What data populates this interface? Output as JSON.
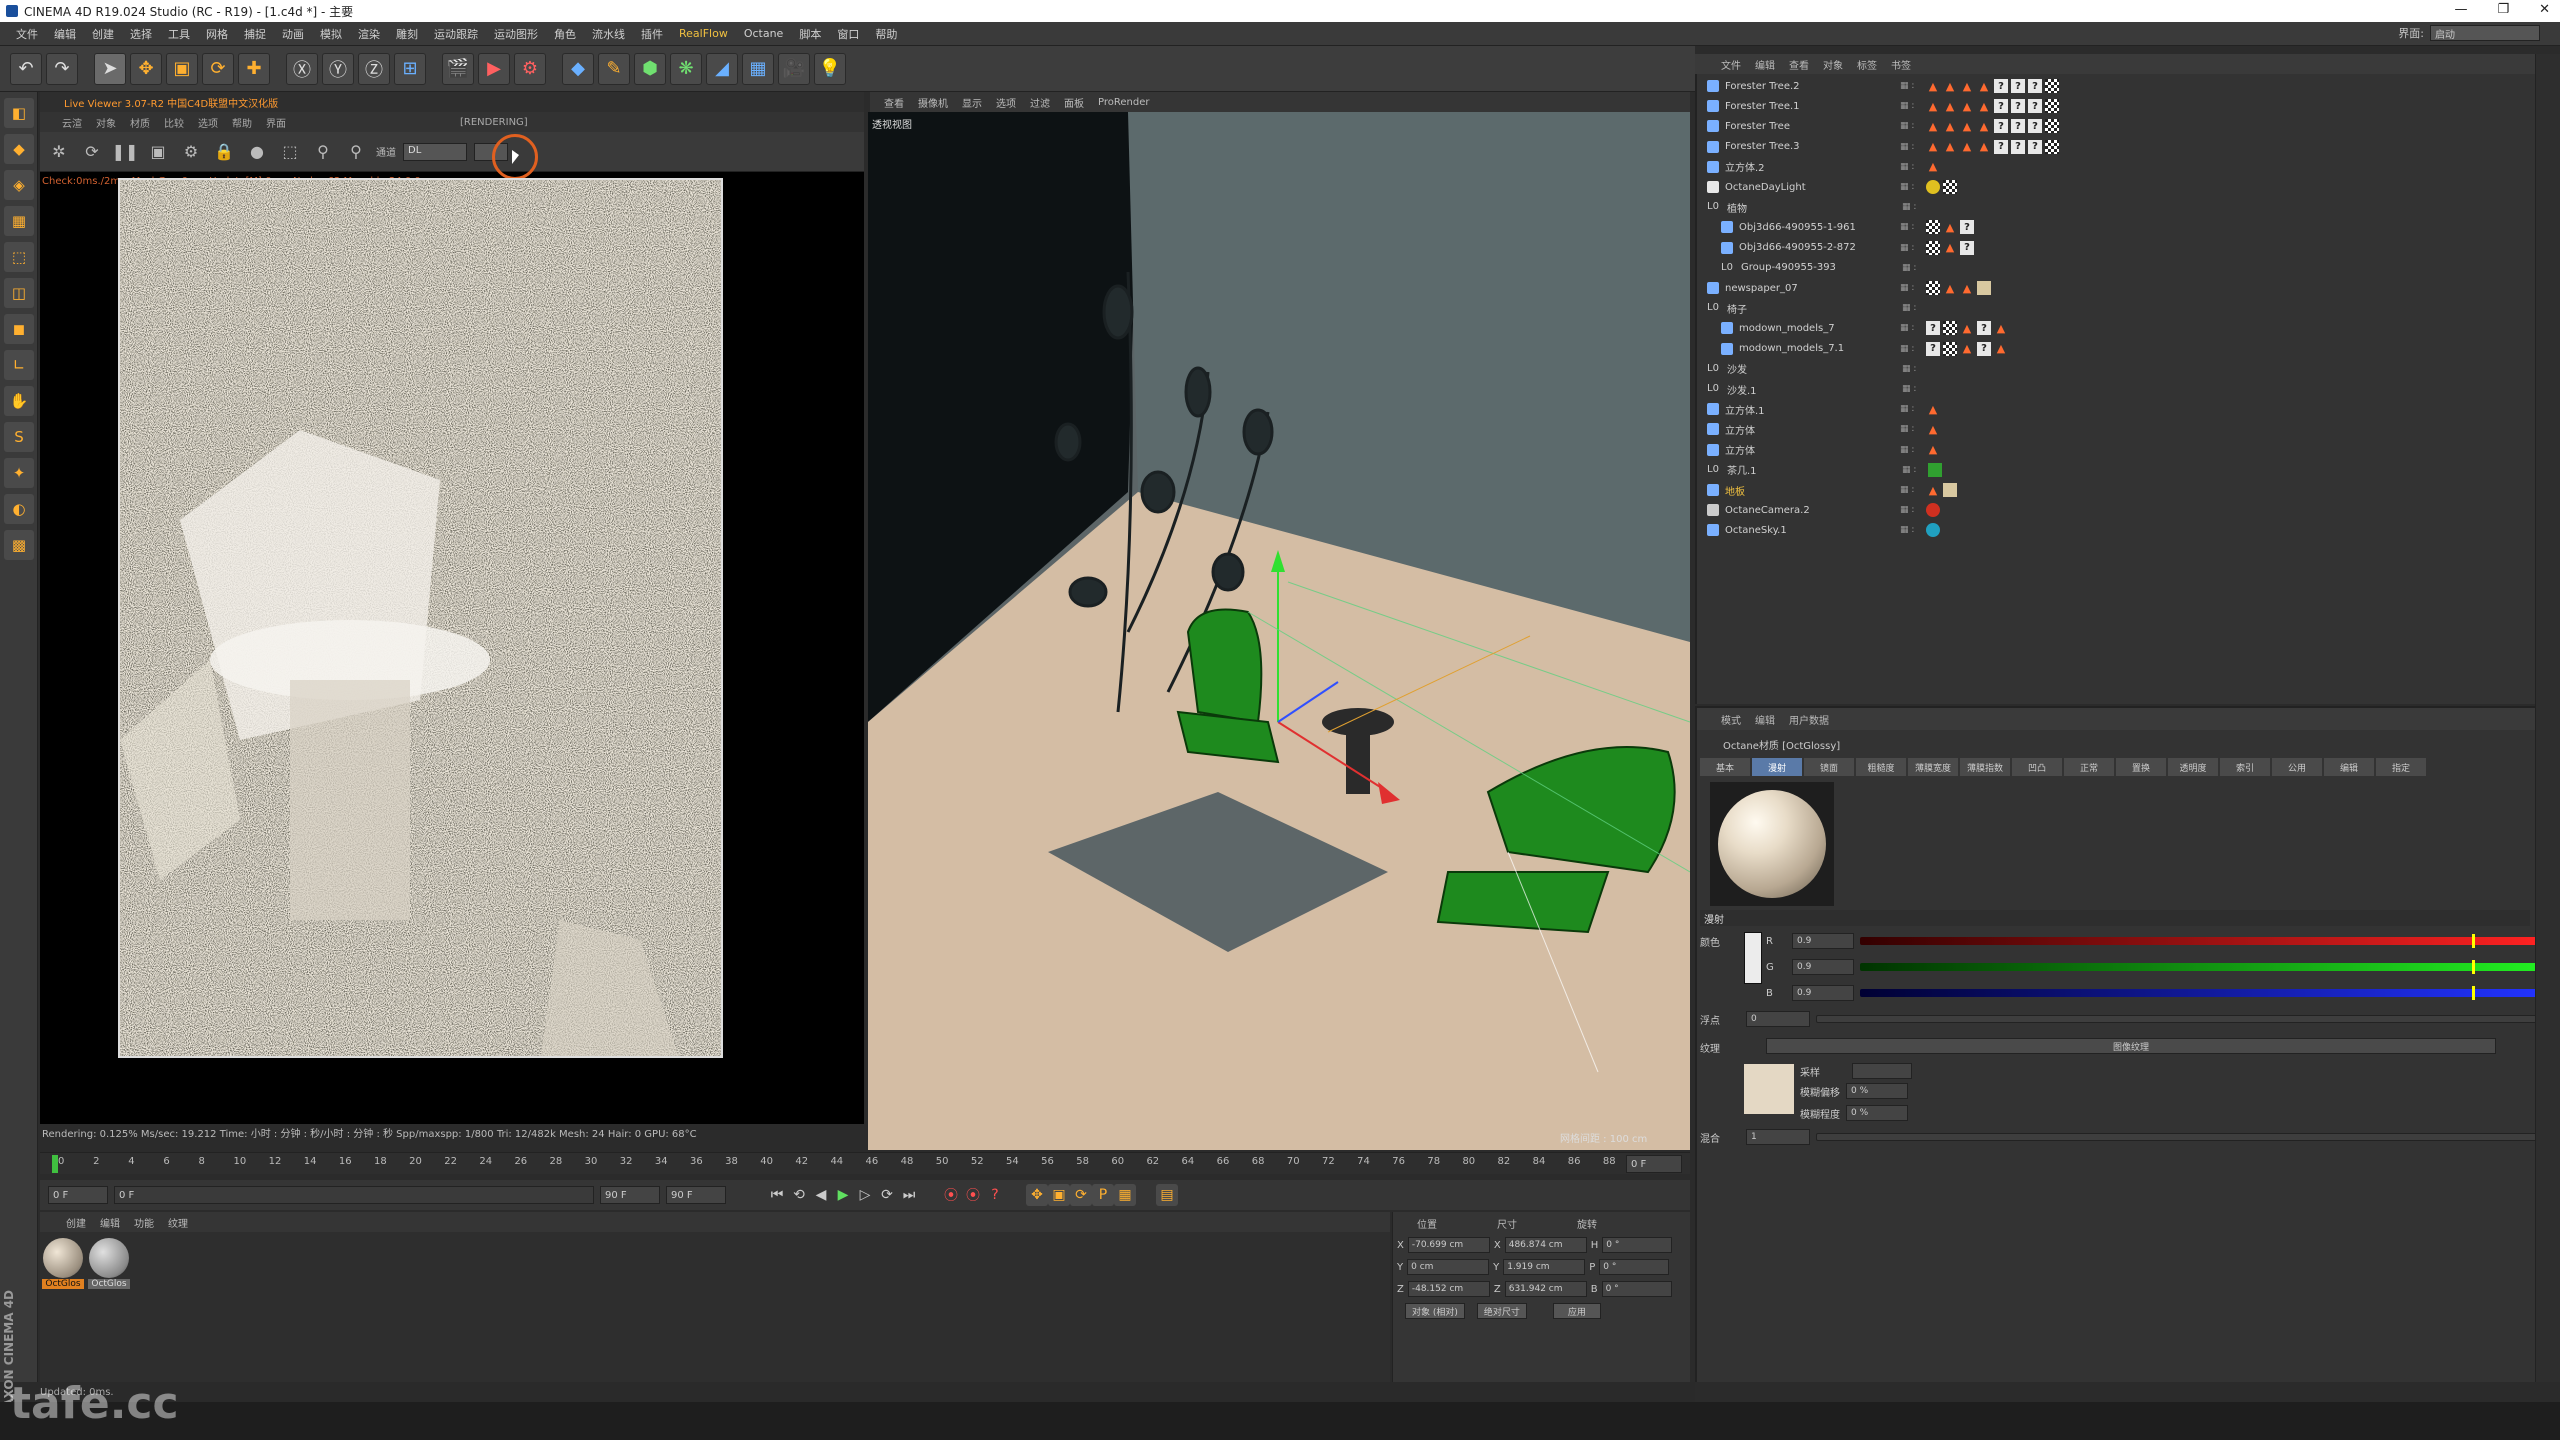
{
  "window": {
    "title": "CINEMA 4D R19.024 Studio (RC - R19) - [1.c4d *] - 主要"
  },
  "menubar": {
    "items": [
      "文件",
      "编辑",
      "创建",
      "选择",
      "工具",
      "网格",
      "捕捉",
      "动画",
      "模拟",
      "渲染",
      "雕刻",
      "运动跟踪",
      "运动图形",
      "角色",
      "流水线",
      "插件",
      "RealFlow",
      "Octane",
      "脚本",
      "窗口",
      "帮助"
    ],
    "layout_label": "界面:",
    "layout_value": "启动"
  },
  "colors": {
    "accent_orange": "#e06020",
    "green_object": "#1e8a1e",
    "floor": "#d9bfa4"
  },
  "live_viewer": {
    "title": "Live Viewer 3.07-R2 中国C4D联盟中文汉化版",
    "menu": [
      "云渲",
      "对象",
      "材质",
      "比较",
      "选项",
      "帮助",
      "界面"
    ],
    "rendering_tag": "[RENDERING]",
    "channel_label": "通道",
    "channel_value": "DL",
    "status_line": "Check:0ms./2ms. MeshGen:0ms. Update[M]:0ms. Nodes:62 Movable:24 0 0",
    "render_status": "Rendering: 0.125%  Ms/sec: 19.212   Time: 小时 : 分钟 : 秒/小时 : 分钟 : 秒   Spp/maxspp: 1/800    Tri: 12/482k   Mesh: 24   Hair: 0    GPU: 68°C"
  },
  "viewport": {
    "menu": [
      "查看",
      "摄像机",
      "显示",
      "选项",
      "过滤",
      "面板",
      "ProRender"
    ],
    "label": "透视视图",
    "grid_text": "网格间距 : 100 cm"
  },
  "timeline": {
    "ticks": [
      "0",
      "2",
      "4",
      "6",
      "8",
      "10",
      "12",
      "14",
      "16",
      "18",
      "20",
      "22",
      "24",
      "26",
      "28",
      "30",
      "32",
      "34",
      "36",
      "38",
      "40",
      "42",
      "44",
      "46",
      "48",
      "50",
      "52",
      "54",
      "56",
      "58",
      "60",
      "62",
      "64",
      "66",
      "68",
      "70",
      "72",
      "74",
      "76",
      "78",
      "80",
      "82",
      "84",
      "86",
      "88",
      "90"
    ],
    "current_frame": "0 F",
    "start": "0 F",
    "range_start": "0 F",
    "range_end": "90 F",
    "end": "90 F"
  },
  "material_manager": {
    "menu": [
      "创建",
      "编辑",
      "功能",
      "纹理"
    ],
    "materials": [
      "OctGlos",
      "OctGlos"
    ]
  },
  "coordinates": {
    "headers": [
      "位置",
      "尺寸",
      "旋转"
    ],
    "rows": [
      {
        "axis": "X",
        "pos": "-70.699 cm",
        "size_axis": "X",
        "size": "486.874 cm",
        "rot_axis": "H",
        "rot": "0 °"
      },
      {
        "axis": "Y",
        "pos": "0 cm",
        "size_axis": "Y",
        "size": "1.919 cm",
        "rot_axis": "P",
        "rot": "0 °"
      },
      {
        "axis": "Z",
        "pos": "-48.152 cm",
        "size_axis": "Z",
        "size": "631.942 cm",
        "rot_axis": "B",
        "rot": "0 °"
      }
    ],
    "mode": "对象 (相对)",
    "size_mode": "绝对尺寸",
    "apply": "应用"
  },
  "object_manager": {
    "menu": [
      "文件",
      "编辑",
      "查看",
      "对象",
      "标签",
      "书签"
    ],
    "objects": [
      {
        "name": "Forester Tree.2",
        "indent": 0,
        "icon": "tree",
        "tags": "trees"
      },
      {
        "name": "Forester Tree.1",
        "indent": 0,
        "icon": "tree",
        "tags": "trees"
      },
      {
        "name": "Forester Tree",
        "indent": 0,
        "icon": "tree",
        "tags": "trees"
      },
      {
        "name": "Forester Tree.3",
        "indent": 0,
        "icon": "tree",
        "tags": "trees"
      },
      {
        "name": "立方体.2",
        "indent": 0,
        "icon": "cube",
        "tags": "one"
      },
      {
        "name": "OctaneDayLight",
        "indent": 0,
        "icon": "light",
        "tags": "light"
      },
      {
        "name": "植物",
        "indent": 0,
        "icon": "null",
        "tags": ""
      },
      {
        "name": "Obj3d66-490955-1-961",
        "indent": 1,
        "icon": "poly",
        "tags": "mix"
      },
      {
        "name": "Obj3d66-490955-2-872",
        "indent": 1,
        "icon": "poly",
        "tags": "mix"
      },
      {
        "name": "Group-490955-393",
        "indent": 1,
        "icon": "null",
        "tags": ""
      },
      {
        "name": "newspaper_07",
        "indent": 0,
        "icon": "poly",
        "tags": "paper"
      },
      {
        "name": "椅子",
        "indent": 0,
        "icon": "null",
        "tags": ""
      },
      {
        "name": "modown_models_7",
        "indent": 1,
        "icon": "poly",
        "tags": "mix2"
      },
      {
        "name": "modown_models_7.1",
        "indent": 1,
        "icon": "poly",
        "tags": "mix2"
      },
      {
        "name": "沙发",
        "indent": 0,
        "icon": "null",
        "tags": ""
      },
      {
        "name": "沙发.1",
        "indent": 0,
        "icon": "null",
        "tags": ""
      },
      {
        "name": "立方体.1",
        "indent": 0,
        "icon": "cube",
        "tags": "one"
      },
      {
        "name": "立方体",
        "indent": 0,
        "icon": "cube",
        "tags": "one"
      },
      {
        "name": "立方体",
        "indent": 0,
        "icon": "cube",
        "tags": "one"
      },
      {
        "name": "茶几.1",
        "indent": 0,
        "icon": "null",
        "tags": "green"
      },
      {
        "name": "地板",
        "indent": 0,
        "icon": "cube",
        "tags": "floor"
      },
      {
        "name": "OctaneCamera.2",
        "indent": 0,
        "icon": "camera",
        "tags": "cam"
      },
      {
        "name": "OctaneSky.1",
        "indent": 0,
        "icon": "sky",
        "tags": "sky"
      }
    ]
  },
  "attributes": {
    "menu": [
      "模式",
      "编辑",
      "用户数据"
    ],
    "title": "Octane材质 [OctGlossy]",
    "tabs": [
      "基本",
      "漫射",
      "镜面",
      "粗糙度",
      "薄膜宽度",
      "薄膜指数",
      "凹凸",
      "正常",
      "置换",
      "透明度",
      "索引",
      "公用",
      "编辑",
      "指定"
    ],
    "active_tab": 1,
    "section": "漫射",
    "color_label": "颜色",
    "r_label": "R",
    "r_value": "0.9",
    "r_level": 0.9,
    "g_label": "G",
    "g_value": "0.9",
    "g_level": 0.9,
    "b_label": "B",
    "b_value": "0.9",
    "b_level": 0.9,
    "float_label": "浮点",
    "float_value": "0",
    "texture_label": "纹理",
    "texture_name": "图像纹理",
    "sampling_label": "采样",
    "blur_offset_label": "模糊偏移",
    "blur_offset_value": "0 %",
    "blur_scale_label": "模糊程度",
    "blur_scale_value": "0 %",
    "mix_label": "混合",
    "mix_value": "1"
  },
  "status": {
    "text": "Updated: 0ms."
  },
  "branding": {
    "maxon": "MAXON CINEMA 4D",
    "watermark": "tafe.cc"
  }
}
